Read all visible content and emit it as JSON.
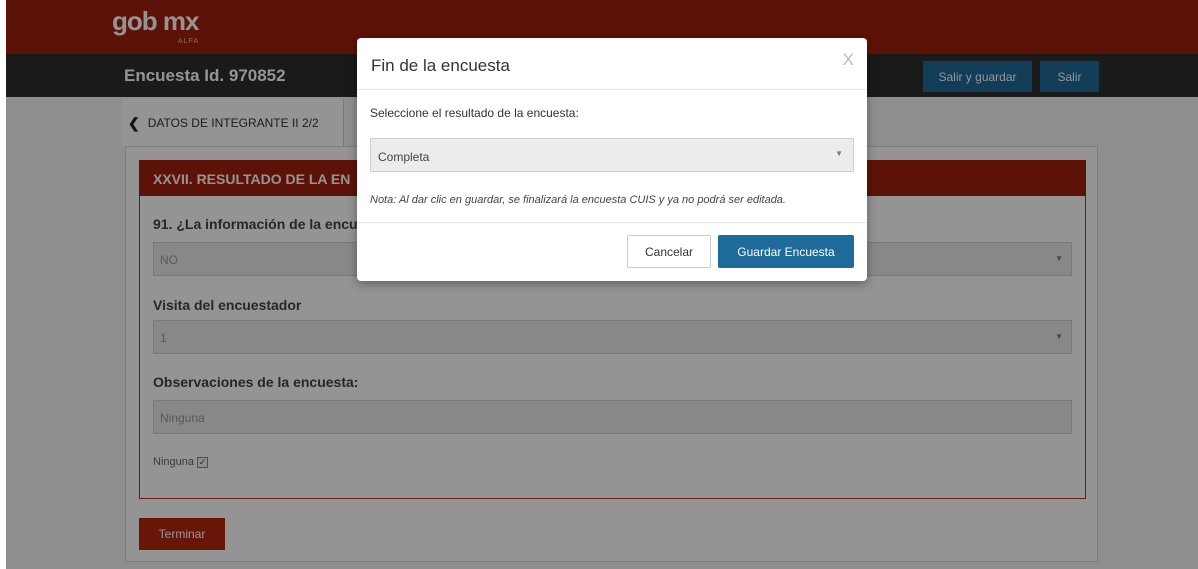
{
  "header": {
    "logo_text": "gob mx",
    "logo_sub": "ALFA",
    "survey_id": "Encuesta Id. 970852",
    "save_exit_label": "Salir y guardar",
    "exit_label": "Salir"
  },
  "breadcrumb": {
    "label": "DATOS DE INTEGRANTE II 2/2"
  },
  "section": {
    "title": "XXVII. RESULTADO DE LA EN",
    "q91_label": "91. ¿La información de la encue",
    "q91_value": "NO",
    "visit_label": "Visita del encuestador",
    "visit_value": "1",
    "obs_label": "Observaciones de la encuesta:",
    "obs_value": "Ninguna",
    "none_checkbox_label": "Ninguna",
    "finish_label": "Terminar"
  },
  "modal": {
    "title": "Fin de la encuesta",
    "close_label": "X",
    "prompt": "Seleccione el resultado de la encuesta:",
    "selected_result": "Completa",
    "note": "Nota: Al dar clic en guardar, se finalizará la encuesta CUIS y ya no podrá ser editada.",
    "cancel_label": "Cancelar",
    "save_label": "Guardar Encuesta"
  },
  "icons": {
    "back": "chevron-left-icon",
    "dropdown": "caret-down-icon",
    "checkbox": "checkbox-checked-icon"
  },
  "colors": {
    "brand_red": "#a0200d",
    "dark_bar": "#2d2d2d",
    "primary_blue": "#1e6a9a"
  }
}
